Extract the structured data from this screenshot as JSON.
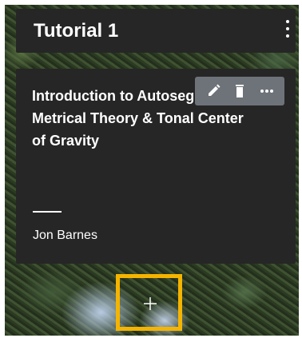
{
  "header": {
    "title": "Tutorial 1",
    "menu_icon": "more-vertical-icon"
  },
  "lesson_card": {
    "title": "Introduction to Autosegmental-Metrical Theory & Tonal Center of Gravity",
    "author": "Jon Barnes",
    "actions": [
      {
        "icon": "pencil-icon"
      },
      {
        "icon": "trash-icon"
      },
      {
        "icon": "more-horizontal-icon"
      }
    ]
  },
  "add_area": {
    "icon": "plus-icon",
    "highlight_color": "#f5b400"
  },
  "colors": {
    "card_background": "#262626",
    "action_bar": "#6e737a"
  }
}
